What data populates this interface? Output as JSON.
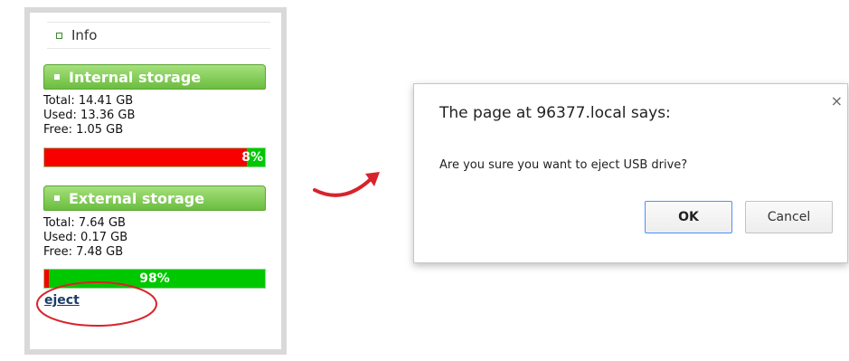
{
  "panel": {
    "info_label": "Info",
    "internal": {
      "title": "Internal storage",
      "total": "Total: 14.41 GB",
      "used": "Used: 13.36 GB",
      "free": "Free: 1.05 GB",
      "free_percent_label": "8%",
      "used_fraction": 0.92
    },
    "external": {
      "title": "External storage",
      "total": "Total: 7.64 GB",
      "used": "Used: 0.17 GB",
      "free": "Free: 7.48 GB",
      "free_percent_label": "98%",
      "used_fraction": 0.02
    },
    "eject_label": "eject"
  },
  "dialog": {
    "title": "The page at 96377.local says:",
    "message": "Are you sure you want to eject USB drive?",
    "ok_label": "OK",
    "cancel_label": "Cancel",
    "close_glyph": "×"
  },
  "colors": {
    "used": "#f80000",
    "free": "#00c800",
    "header_green": "#6bbd3f",
    "annotation_red": "#d8232a"
  }
}
